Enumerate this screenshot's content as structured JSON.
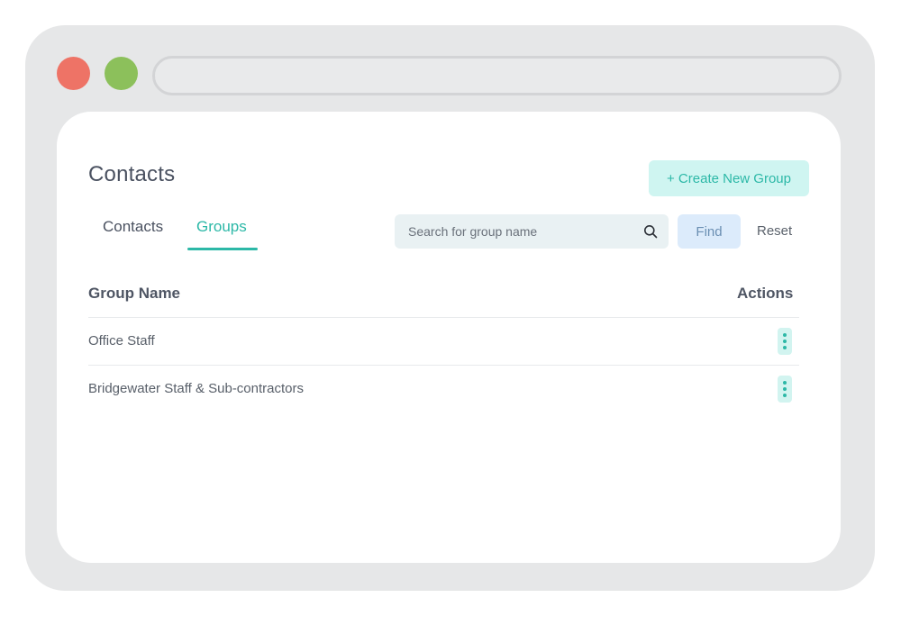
{
  "page": {
    "title": "Contacts"
  },
  "header": {
    "create_button_label": "+ Create New Group"
  },
  "tabs": [
    {
      "label": "Contacts",
      "active": false
    },
    {
      "label": "Groups",
      "active": true
    }
  ],
  "search": {
    "placeholder": "Search for group name",
    "value": "",
    "find_label": "Find",
    "reset_label": "Reset"
  },
  "table": {
    "columns": [
      "Group Name",
      "Actions"
    ],
    "rows": [
      {
        "name": "Office Staff"
      },
      {
        "name": "Bridgewater Staff & Sub-contractors"
      }
    ]
  },
  "colors": {
    "accent": "#2cb8a7",
    "frame": "#e6e7e8",
    "traffic_red": "#ee7366",
    "traffic_green": "#8cc05b"
  },
  "icons": {
    "search": "search-icon",
    "row_action": "more-vertical-icon"
  }
}
